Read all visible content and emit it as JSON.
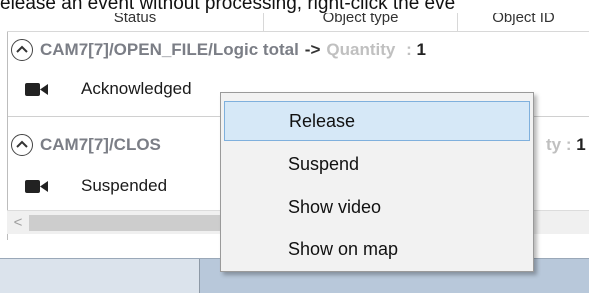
{
  "caption": "elease an event without processing, right-click the eve",
  "table": {
    "columns": [
      "Status",
      "Object type",
      "Object ID"
    ]
  },
  "groups": [
    {
      "title": "CAM7[7]/OPEN_FILE/Logic total",
      "arrow": "->",
      "quantity_label": "Quantity",
      "quantity_sep": " : ",
      "quantity_value": "1",
      "event": {
        "status": "Acknowledged",
        "icon": "camera-icon"
      }
    },
    {
      "title": "CAM7[7]/CLOS",
      "quantity_label": "ty",
      "quantity_sep": " : ",
      "quantity_value": "1",
      "event": {
        "status": "Suspended",
        "icon": "camera-icon"
      }
    }
  ],
  "scrollbar": {
    "left_arrow": "<"
  },
  "context_menu": {
    "items": [
      "Release",
      "Suspend",
      "Show video",
      "Show on map"
    ],
    "highlighted_index": 0
  },
  "colors": {
    "group_title": "#7b7e86",
    "quantity_label": "#c0c0c0",
    "menu_highlight": "#d6e8f7",
    "menu_highlight_border": "#7fb0dd"
  }
}
